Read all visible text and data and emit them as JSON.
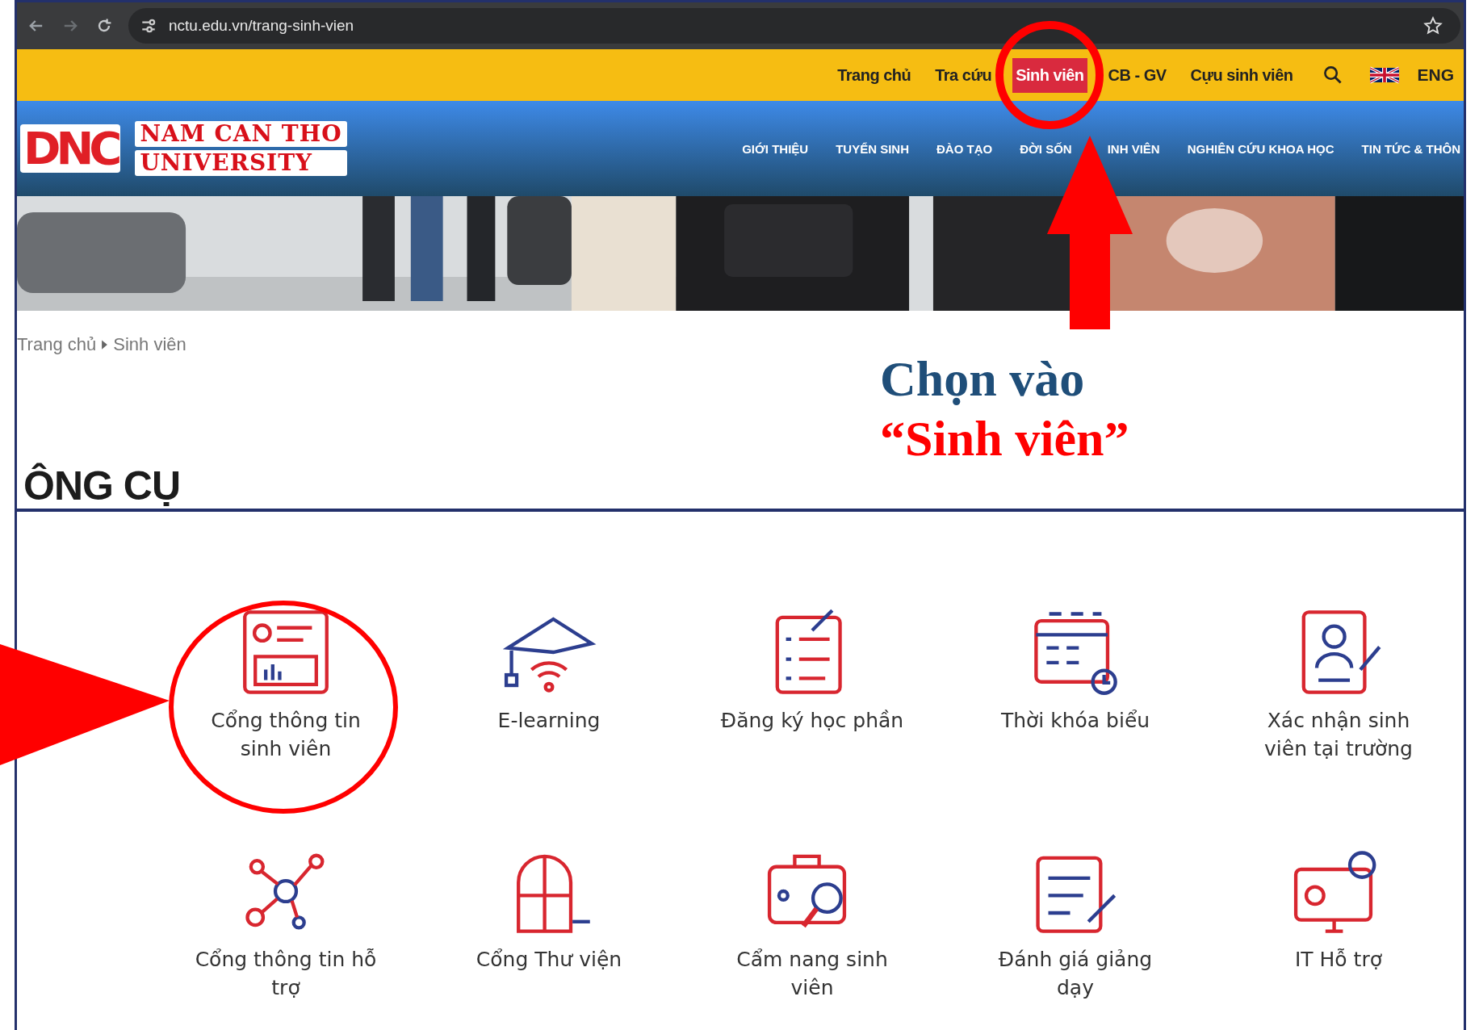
{
  "browser": {
    "url": "nctu.edu.vn/trang-sinh-vien"
  },
  "top_links": [
    {
      "label": "Trang chủ",
      "selected": false
    },
    {
      "label": "Tra cứu",
      "selected": false
    },
    {
      "label": "Sinh viên",
      "selected": true
    },
    {
      "label": "CB - GV",
      "selected": false
    },
    {
      "label": "Cựu sinh viên",
      "selected": false
    }
  ],
  "language": "ENG",
  "logo": {
    "mark": "DNC",
    "line_1": "NAM CAN THO",
    "line_2": "UNIVERSITY"
  },
  "nav_items": [
    {
      "parts": [
        "GIỚI THIỆU"
      ]
    },
    {
      "parts": [
        "TUYỂN SINH"
      ]
    },
    {
      "parts": [
        "ĐÀO TẠO"
      ]
    },
    {
      "parts": [
        "ĐỜI SỐN",
        "INH VIÊN"
      ]
    },
    {
      "parts": [
        "NGHIÊN CỨU KHOA HỌC"
      ]
    },
    {
      "parts": [
        "TIN TỨC & THÔN"
      ]
    }
  ],
  "breadcrumb": [
    "Trang chủ",
    "Sinh viên"
  ],
  "annotation": {
    "line_1": "Chọn vào",
    "line_2": "“Sinh viên”"
  },
  "section_title": "ÔNG CỤ",
  "tools": [
    {
      "label": "Cổng thông tin sinh viên",
      "kind": "profile"
    },
    {
      "label": "E-learning",
      "kind": "elearning"
    },
    {
      "label": "Đăng ký học phần",
      "kind": "checklist"
    },
    {
      "label": "Thời khóa biểu",
      "kind": "calendar"
    },
    {
      "label": "Xác nhận sinh viên tại trường",
      "kind": "idcard"
    },
    {
      "label": "Cổng thông tin hỗ trợ",
      "kind": "network"
    },
    {
      "label": "Cổng Thư viện",
      "kind": "window"
    },
    {
      "label": "Cẩm nang sinh viên",
      "kind": "briefcase"
    },
    {
      "label": "Đánh giá giảng dạy",
      "kind": "document"
    },
    {
      "label": "IT Hỗ trợ",
      "kind": "monitor"
    }
  ]
}
